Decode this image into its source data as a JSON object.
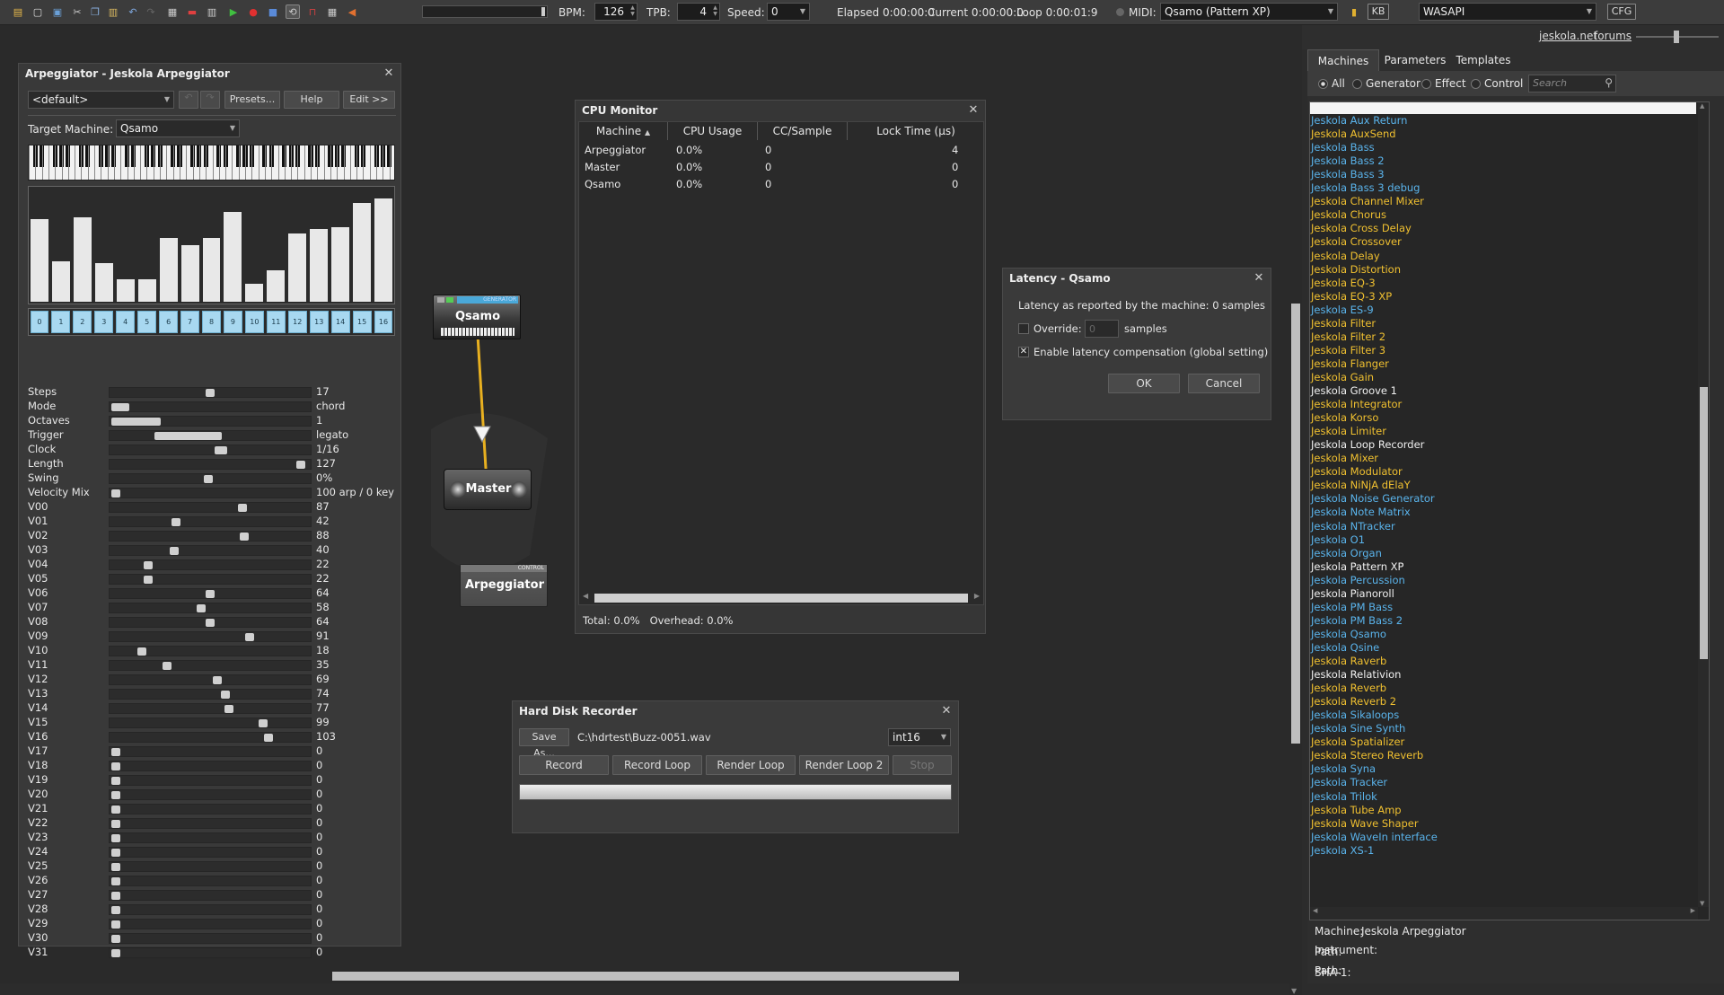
{
  "toolbar": {
    "bpm_label": "BPM:",
    "bpm": "126",
    "tpb_label": "TPB:",
    "tpb": "4",
    "speed_label": "Speed:",
    "speed": "0",
    "elapsed": "Elapsed 0:00:00:0",
    "current": "Current 0:00:00:0",
    "loop": "Loop 0:00:01:9",
    "midi_label": "MIDI:",
    "midi_device": "Qsamo (Pattern XP)",
    "kb": "KB",
    "audio_driver": "WASAPI",
    "cfg": "CFG"
  },
  "links": {
    "jeskola": "jeskola.net",
    "forums": "forums"
  },
  "arp": {
    "title": "Arpeggiator - Jeskola Arpeggiator",
    "preset": "<default>",
    "presets_btn": "Presets...",
    "help_btn": "Help",
    "edit_btn": "Edit >>",
    "target_label": "Target Machine:",
    "target": "Qsamo",
    "bars": [
      0.73,
      0.36,
      0.75,
      0.34,
      0.2,
      0.2,
      0.56,
      0.5,
      0.56,
      0.79,
      0.16,
      0.28,
      0.6,
      0.64,
      0.66,
      0.87,
      0.91
    ],
    "steps": [
      "0",
      "1",
      "2",
      "3",
      "4",
      "5",
      "6",
      "7",
      "8",
      "9",
      "10",
      "11",
      "12",
      "13",
      "14",
      "15",
      "16"
    ],
    "params": [
      {
        "label": "Steps",
        "value": "17",
        "pos": 0.5,
        "w": 10
      },
      {
        "label": "Mode",
        "value": "chord",
        "pos": 0.0,
        "w": 20
      },
      {
        "label": "Octaves",
        "value": "1",
        "pos": 0.0,
        "w": 55
      },
      {
        "label": "Trigger",
        "value": "legato",
        "pos": 0.33,
        "w": 75
      },
      {
        "label": "Clock",
        "value": "1/16",
        "pos": 0.56,
        "w": 14
      },
      {
        "label": "Length",
        "value": "127",
        "pos": 0.98,
        "w": 10
      },
      {
        "label": "Swing",
        "value": "0%",
        "pos": 0.49,
        "w": 10
      },
      {
        "label": "Velocity Mix",
        "value": "100 arp / 0 key",
        "pos": 0.0,
        "w": 10
      },
      {
        "label": "V00",
        "value": "87",
        "pos": 0.67,
        "w": 10
      },
      {
        "label": "V01",
        "value": "42",
        "pos": 0.32,
        "w": 10
      },
      {
        "label": "V02",
        "value": "88",
        "pos": 0.68,
        "w": 10
      },
      {
        "label": "V03",
        "value": "40",
        "pos": 0.31,
        "w": 10
      },
      {
        "label": "V04",
        "value": "22",
        "pos": 0.17,
        "w": 10
      },
      {
        "label": "V05",
        "value": "22",
        "pos": 0.17,
        "w": 10
      },
      {
        "label": "V06",
        "value": "64",
        "pos": 0.5,
        "w": 10
      },
      {
        "label": "V07",
        "value": "58",
        "pos": 0.45,
        "w": 10
      },
      {
        "label": "V08",
        "value": "64",
        "pos": 0.5,
        "w": 10
      },
      {
        "label": "V09",
        "value": "91",
        "pos": 0.71,
        "w": 10
      },
      {
        "label": "V10",
        "value": "18",
        "pos": 0.14,
        "w": 10
      },
      {
        "label": "V11",
        "value": "35",
        "pos": 0.27,
        "w": 10
      },
      {
        "label": "V12",
        "value": "69",
        "pos": 0.54,
        "w": 10
      },
      {
        "label": "V13",
        "value": "74",
        "pos": 0.58,
        "w": 10
      },
      {
        "label": "V14",
        "value": "77",
        "pos": 0.6,
        "w": 10
      },
      {
        "label": "V15",
        "value": "99",
        "pos": 0.78,
        "w": 10
      },
      {
        "label": "V16",
        "value": "103",
        "pos": 0.81,
        "w": 10
      },
      {
        "label": "V17",
        "value": "0",
        "pos": 0.0,
        "w": 10
      },
      {
        "label": "V18",
        "value": "0",
        "pos": 0.0,
        "w": 10
      },
      {
        "label": "V19",
        "value": "0",
        "pos": 0.0,
        "w": 10
      },
      {
        "label": "V20",
        "value": "0",
        "pos": 0.0,
        "w": 10
      },
      {
        "label": "V21",
        "value": "0",
        "pos": 0.0,
        "w": 10
      },
      {
        "label": "V22",
        "value": "0",
        "pos": 0.0,
        "w": 10
      },
      {
        "label": "V23",
        "value": "0",
        "pos": 0.0,
        "w": 10
      },
      {
        "label": "V24",
        "value": "0",
        "pos": 0.0,
        "w": 10
      },
      {
        "label": "V25",
        "value": "0",
        "pos": 0.0,
        "w": 10
      },
      {
        "label": "V26",
        "value": "0",
        "pos": 0.0,
        "w": 10
      },
      {
        "label": "V27",
        "value": "0",
        "pos": 0.0,
        "w": 10
      },
      {
        "label": "V28",
        "value": "0",
        "pos": 0.0,
        "w": 10
      },
      {
        "label": "V29",
        "value": "0",
        "pos": 0.0,
        "w": 10
      },
      {
        "label": "V30",
        "value": "0",
        "pos": 0.0,
        "w": 10
      },
      {
        "label": "V31",
        "value": "0",
        "pos": 0.0,
        "w": 10
      }
    ]
  },
  "machines_graph": {
    "qsamo": "Qsamo",
    "master": "Master",
    "arpeggiator": "Arpeggiator",
    "qsamo_tag": "GENERATOR",
    "arp_tag": "CONTROL"
  },
  "cpu": {
    "title": "CPU Monitor",
    "headers": [
      "Machine",
      "CPU Usage",
      "CC/Sample",
      "Lock Time (µs)"
    ],
    "rows": [
      [
        "Arpeggiator",
        "0.0%",
        "0",
        "4"
      ],
      [
        "Master",
        "0.0%",
        "0",
        "0"
      ],
      [
        "Qsamo",
        "0.0%",
        "0",
        "0"
      ]
    ],
    "footer": "Total: 0.0%   Overhead: 0.0%"
  },
  "latency": {
    "title": "Latency - Qsamo",
    "reported": "Latency as reported by the machine: 0 samples",
    "override_label": "Override:",
    "override_value": "0",
    "samples": "samples",
    "comp_label": "Enable latency compensation (global setting)",
    "ok": "OK",
    "cancel": "Cancel"
  },
  "hdr": {
    "title": "Hard Disk Recorder",
    "save_as": "Save As...",
    "path": "C:\\hdrtest\\Buzz-0051.wav",
    "format": "int16",
    "buttons": [
      "Record",
      "Record Loop",
      "Render Loop",
      "Render Loop 2",
      "Stop"
    ]
  },
  "browser": {
    "tabs": [
      "Machines",
      "Parameters",
      "Templates"
    ],
    "filters": [
      "All",
      "Generator",
      "Effect",
      "Control"
    ],
    "search_placeholder": "Search",
    "colors": {
      "effect": "#f0c030",
      "generator": "#5ab4ec",
      "control": "#f0f0f0"
    },
    "items": [
      {
        "name": "Jeskola Aux Return",
        "kind": "generator"
      },
      {
        "name": "Jeskola AuxSend",
        "kind": "effect"
      },
      {
        "name": "Jeskola Bass",
        "kind": "generator"
      },
      {
        "name": "Jeskola Bass 2",
        "kind": "generator"
      },
      {
        "name": "Jeskola Bass 3",
        "kind": "generator"
      },
      {
        "name": "Jeskola Bass 3 debug",
        "kind": "generator"
      },
      {
        "name": "Jeskola Channel Mixer",
        "kind": "effect"
      },
      {
        "name": "Jeskola Chorus",
        "kind": "effect"
      },
      {
        "name": "Jeskola Cross Delay",
        "kind": "effect"
      },
      {
        "name": "Jeskola Crossover",
        "kind": "effect"
      },
      {
        "name": "Jeskola Delay",
        "kind": "effect"
      },
      {
        "name": "Jeskola Distortion",
        "kind": "effect"
      },
      {
        "name": "Jeskola EQ-3",
        "kind": "effect"
      },
      {
        "name": "Jeskola EQ-3 XP",
        "kind": "effect"
      },
      {
        "name": "Jeskola ES-9",
        "kind": "generator"
      },
      {
        "name": "Jeskola Filter",
        "kind": "effect"
      },
      {
        "name": "Jeskola Filter 2",
        "kind": "effect"
      },
      {
        "name": "Jeskola Filter 3",
        "kind": "effect"
      },
      {
        "name": "Jeskola Flanger",
        "kind": "effect"
      },
      {
        "name": "Jeskola Gain",
        "kind": "effect"
      },
      {
        "name": "Jeskola Groove 1",
        "kind": "control"
      },
      {
        "name": "Jeskola Integrator",
        "kind": "effect"
      },
      {
        "name": "Jeskola Korso",
        "kind": "effect"
      },
      {
        "name": "Jeskola Limiter",
        "kind": "effect"
      },
      {
        "name": "Jeskola Loop Recorder",
        "kind": "control"
      },
      {
        "name": "Jeskola Mixer",
        "kind": "effect"
      },
      {
        "name": "Jeskola Modulator",
        "kind": "effect"
      },
      {
        "name": "Jeskola NiNjA dElaY",
        "kind": "effect"
      },
      {
        "name": "Jeskola Noise Generator",
        "kind": "generator"
      },
      {
        "name": "Jeskola Note Matrix",
        "kind": "generator"
      },
      {
        "name": "Jeskola NTracker",
        "kind": "generator"
      },
      {
        "name": "Jeskola O1",
        "kind": "generator"
      },
      {
        "name": "Jeskola Organ",
        "kind": "generator"
      },
      {
        "name": "Jeskola Pattern XP",
        "kind": "control"
      },
      {
        "name": "Jeskola Percussion",
        "kind": "generator"
      },
      {
        "name": "Jeskola Pianoroll",
        "kind": "control"
      },
      {
        "name": "Jeskola PM Bass",
        "kind": "generator"
      },
      {
        "name": "Jeskola PM Bass 2",
        "kind": "generator"
      },
      {
        "name": "Jeskola Qsamo",
        "kind": "generator"
      },
      {
        "name": "Jeskola Qsine",
        "kind": "generator"
      },
      {
        "name": "Jeskola Raverb",
        "kind": "effect"
      },
      {
        "name": "Jeskola Relativion",
        "kind": "control"
      },
      {
        "name": "Jeskola Reverb",
        "kind": "effect"
      },
      {
        "name": "Jeskola Reverb 2",
        "kind": "effect"
      },
      {
        "name": "Jeskola Sikaloops",
        "kind": "generator"
      },
      {
        "name": "Jeskola Sine Synth",
        "kind": "generator"
      },
      {
        "name": "Jeskola Spatializer",
        "kind": "effect"
      },
      {
        "name": "Jeskola Stereo Reverb",
        "kind": "effect"
      },
      {
        "name": "Jeskola Syna",
        "kind": "generator"
      },
      {
        "name": "Jeskola Tracker",
        "kind": "generator"
      },
      {
        "name": "Jeskola Trilok",
        "kind": "generator"
      },
      {
        "name": "Jeskola Tube Amp",
        "kind": "effect"
      },
      {
        "name": "Jeskola Wave Shaper",
        "kind": "effect"
      },
      {
        "name": "Jeskola WaveIn interface",
        "kind": "generator"
      },
      {
        "name": "Jeskola XS-1",
        "kind": "generator"
      }
    ],
    "info": {
      "machine_label": "Machine:",
      "machine_value": "Jeskola Arpeggiator",
      "path_label": "Path:",
      "sha_label": "SHA-1:",
      "instrument_label": "Instrument:",
      "path2_label": "Path:"
    }
  }
}
